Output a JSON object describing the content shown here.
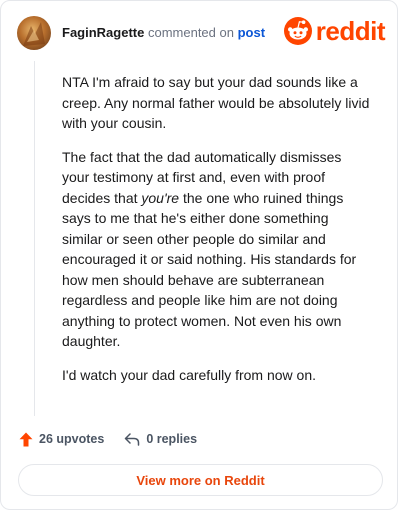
{
  "comment": {
    "username": "FaginRagette",
    "action_text": "commented on",
    "post_link_text": "post",
    "paragraphs": [
      {
        "text": "NTA I'm afraid to say but your dad sounds like a creep. Any normal father would be absolutely livid with your cousin."
      },
      {
        "before": "The fact that the dad automatically dismisses your testimony at first and, even with proof decides that ",
        "emphasis": "you're",
        "after": " the one who ruined things says to me that he's either done something similar or seen other people do similar and encouraged it or said nothing. His standards for how men should behave are subterranean regardless and people like him are not doing anything to protect women. Not even his own daughter."
      },
      {
        "text": "I'd watch your dad carefully from now on."
      }
    ]
  },
  "brand": {
    "wordmark": "reddit",
    "color": "#ff4500"
  },
  "actions": {
    "upvotes_label": "26 upvotes",
    "replies_label": "0 replies"
  },
  "view_button_label": "View more on Reddit",
  "icons": {
    "avatar": "user-avatar",
    "logo": "reddit-snoo-icon",
    "upvote": "upvote-arrow-icon",
    "reply": "reply-arrow-icon"
  }
}
